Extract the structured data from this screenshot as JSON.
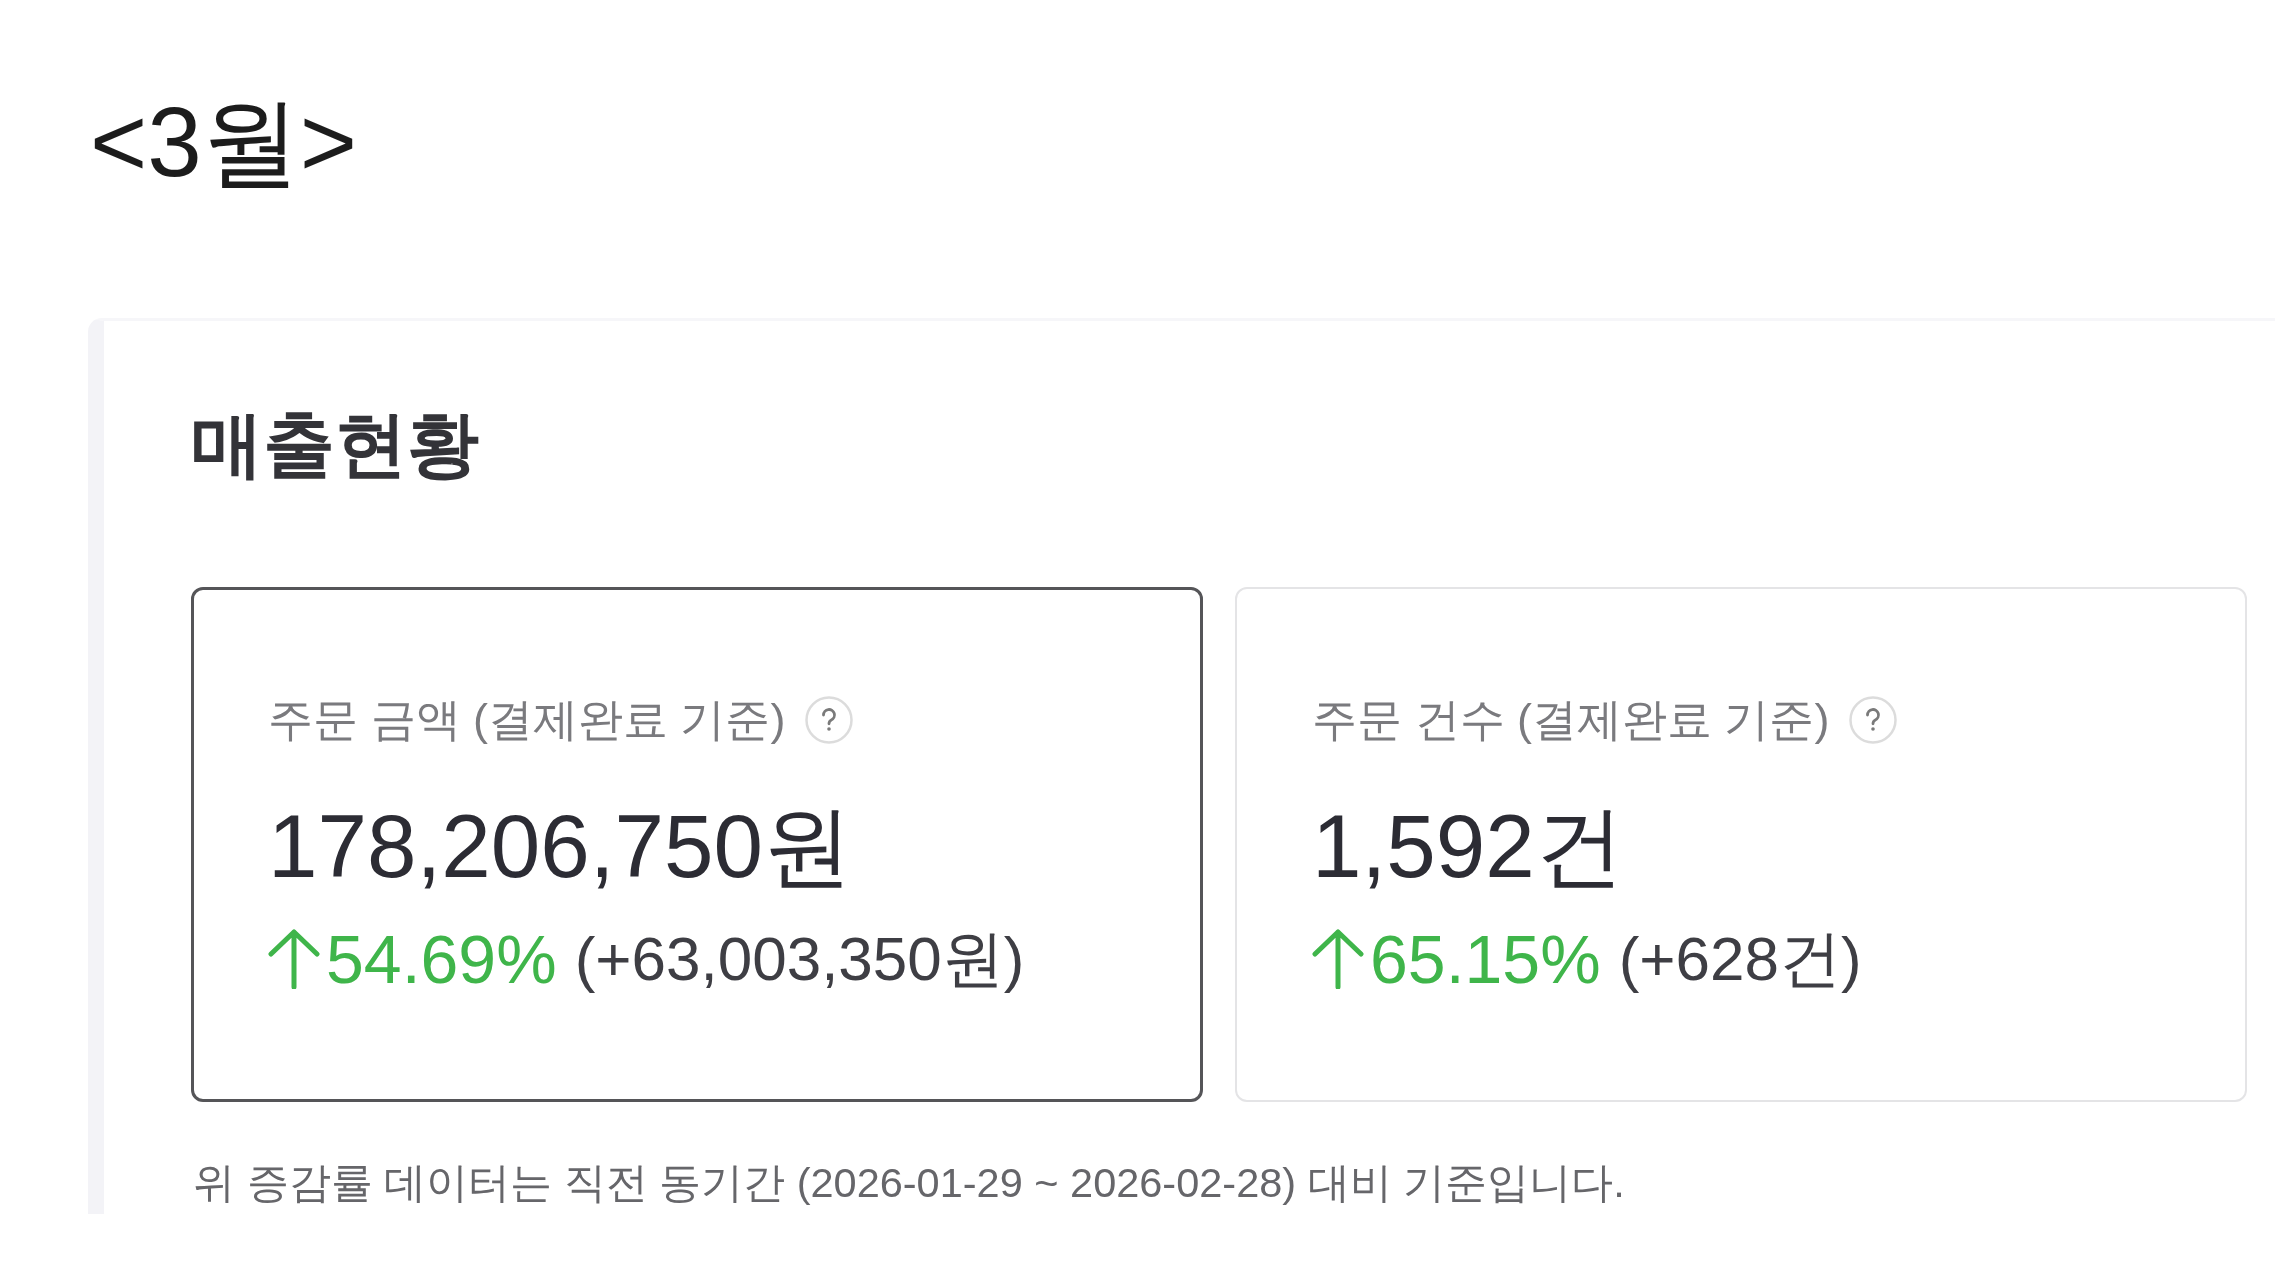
{
  "page_title": "<3월>",
  "panel": {
    "heading": "매출현황",
    "cards": [
      {
        "label": "주문 금액 (결제완료 기준)",
        "value": "178,206,750원",
        "change": {
          "kind": "increase",
          "percent": "54.69%",
          "amount": "(+63,003,350원)"
        },
        "selected": true
      },
      {
        "label": "주문 건수 (결제완료 기준)",
        "value": "1,592건",
        "change": {
          "kind": "increase",
          "percent": "65.15%",
          "amount": "(+628건)"
        },
        "selected": false
      }
    ],
    "footnote": "위 증감률 데이터는 직전 동기간 (2026-01-29 ~ 2026-02-28) 대비 기준입니다."
  }
}
